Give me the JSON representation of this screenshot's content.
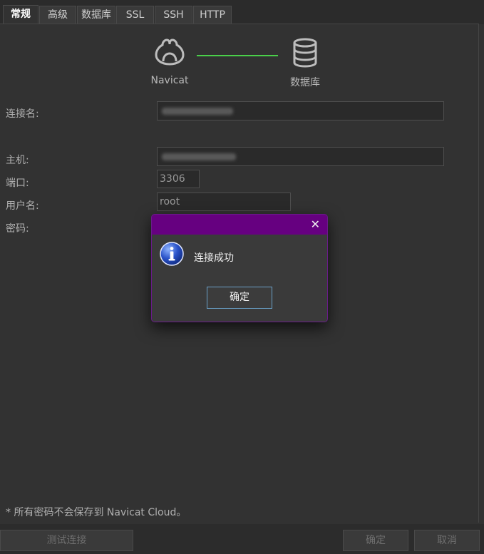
{
  "tabs": [
    "常规",
    "高级",
    "数据库",
    "SSL",
    "SSH",
    "HTTP"
  ],
  "header": {
    "left_label": "Navicat",
    "right_label": "数据库",
    "link_color": "#4ad04a"
  },
  "form": {
    "connection_name_label": "连接名:",
    "host_label": "主机:",
    "port_label": "端口:",
    "port_value": "3306",
    "user_label": "用户名:",
    "user_value": "root",
    "password_label": "密码:"
  },
  "note": "* 所有密码不会保存到 Navicat Cloud。",
  "buttons": {
    "test": "测试连接",
    "ok": "确定",
    "cancel": "取消"
  },
  "dialog": {
    "message": "连接成功",
    "ok_label": "确定",
    "close_glyph": "✕",
    "title_color": "#660080"
  }
}
